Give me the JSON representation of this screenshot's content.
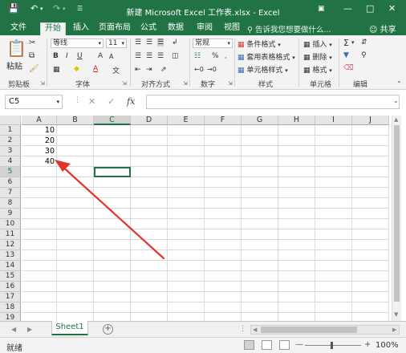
{
  "titlebar": {
    "title": "新建 Microsoft Excel 工作表.xlsx - Excel",
    "save_icon": "save-icon",
    "undo_icon": "undo-icon",
    "redo_icon": "redo-icon"
  },
  "tabs": [
    "文件",
    "开始",
    "插入",
    "页面布局",
    "公式",
    "数据",
    "审阅",
    "视图"
  ],
  "active_tab": "开始",
  "tell_me": "告诉我您想要做什么...",
  "share": "共享",
  "ribbon": {
    "clipboard": {
      "paste": "粘贴",
      "label": "剪贴板"
    },
    "font": {
      "name": "等线",
      "size": "11",
      "bold": "B",
      "italic": "I",
      "underline": "U",
      "grow": "A",
      "shrink": "A",
      "font_color": "A",
      "label": "字体"
    },
    "alignment": {
      "label": "对齐方式"
    },
    "number": {
      "format": "常规",
      "percent": "%",
      "label": "数字"
    },
    "styles": {
      "conditional": "条件格式",
      "table": "套用表格格式",
      "cell_styles": "单元格样式",
      "label": "样式"
    },
    "cells": {
      "insert": "插入",
      "delete": "删除",
      "format": "格式",
      "label": "单元格"
    },
    "editing": {
      "sum": "Σ",
      "label": "编辑"
    }
  },
  "formula_bar": {
    "name_box": "C5",
    "cancel": "✕",
    "enter": "✓",
    "fx": "fx",
    "value": ""
  },
  "grid": {
    "columns": [
      "A",
      "B",
      "C",
      "D",
      "E",
      "F",
      "G",
      "H",
      "I",
      "J"
    ],
    "selected_column": "C",
    "rows": [
      "1",
      "2",
      "3",
      "4",
      "5",
      "6",
      "7",
      "8",
      "9",
      "10",
      "11",
      "12",
      "13",
      "14",
      "15",
      "16",
      "17",
      "18",
      "19"
    ],
    "selected_row": "5",
    "cells": {
      "A1": "10",
      "A2": "20",
      "A3": "30",
      "A4": "40"
    },
    "active_cell": "C5"
  },
  "sheet_tab": "Sheet1",
  "status": {
    "ready": "就绪",
    "zoom": "100%"
  },
  "annotation": {
    "color": "#e2352c"
  }
}
